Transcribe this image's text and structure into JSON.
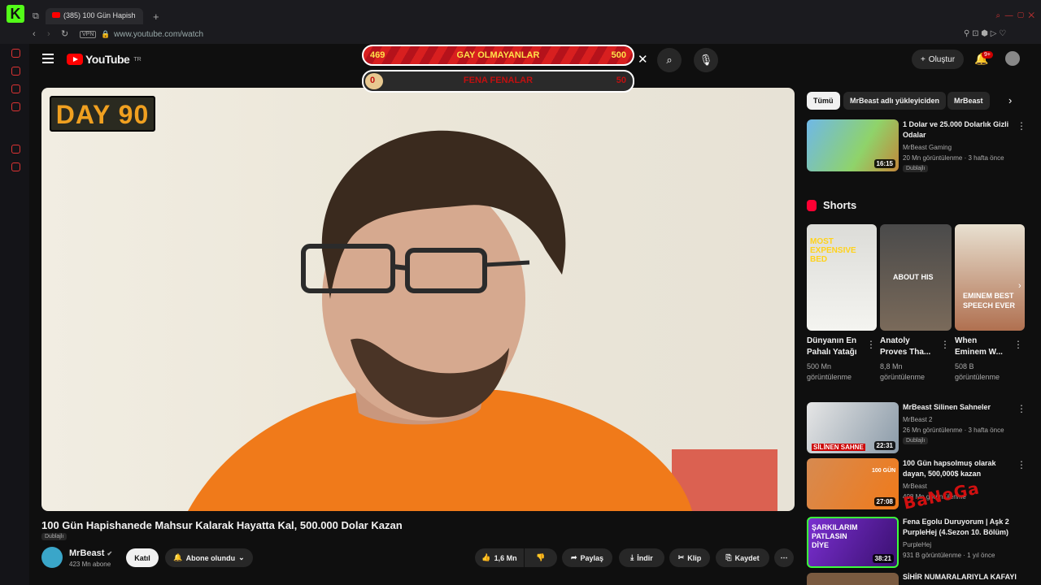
{
  "browser": {
    "tab_title": "(385) 100 Gün Hapish",
    "url": "www.youtube.com/watch",
    "vpn_label": "VPN"
  },
  "youtube": {
    "logo_text": "YouTube",
    "region": "TR",
    "create_label": "Oluştur",
    "notif_count": "9+"
  },
  "overlay": {
    "bar1": {
      "left": "469",
      "title": "GAY OLMAYANLAR",
      "right": "500"
    },
    "bar2": {
      "left": "0",
      "title": "FENA FENALAR",
      "right": "50"
    }
  },
  "video": {
    "badge": "DAY 90",
    "title": "100 Gün Hapishanede Mahsur Kalarak Hayatta Kal, 500.000 Dolar Kazan",
    "dubbed": "Dublajlı",
    "channel": "MrBeast",
    "subs": "423 Mn abone",
    "join": "Katıl",
    "subscribed": "Abone olundu",
    "likes": "1,6 Mn",
    "share": "Paylaş",
    "download": "İndir",
    "clip": "Klip",
    "save": "Kaydet"
  },
  "chips": [
    "Tümü",
    "MrBeast adlı yükleyiciden",
    "MrBeast"
  ],
  "recs": [
    {
      "title1": "1 Dolar ve 25.000 Dolarlık Gizli",
      "title2": "Odalar",
      "channel": "MrBeast Gaming",
      "meta": "20 Mn görüntülenme · 3 hafta önce",
      "badge": "Dublajlı",
      "dur": "16:15"
    },
    {
      "title1": "MrBeast Silinen Sahneler",
      "title2": "",
      "channel": "MrBeast 2",
      "meta": "26 Mn görüntülenme · 3 hafta önce",
      "badge": "Dublajlı",
      "dur": "22:31"
    },
    {
      "title1": "100 Gün hapsolmuş olarak",
      "title2": "dayan, 500,000$ kazan",
      "channel": "MrBeast",
      "meta": "408 Mn görüntülenme",
      "badge": "",
      "dur": "27:08"
    },
    {
      "title1": "Fena Egolu Duruyorum | Aşk 2",
      "title2": "PurpleHej (4.Sezon 10. Bölüm)",
      "channel": "PurpleHej",
      "meta": "931 B görüntülenme · 1 yıl önce",
      "badge": "",
      "dur": "38:21"
    },
    {
      "title1": "SİHİR NUMARALARIYLA KAFAYI",
      "title2": "",
      "channel": "",
      "meta": "",
      "badge": "",
      "dur": ""
    }
  ],
  "shorts": {
    "heading": "Shorts",
    "items": [
      {
        "t1": "Dünyanın En",
        "t2": "Pahalı Yatağı",
        "v1": "500 Mn",
        "v2": "görüntülenme",
        "thumb_text": "MOST EXPENSIVE BED"
      },
      {
        "t1": "Anatoly",
        "t2": "Proves Tha...",
        "v1": "8,8 Mn",
        "v2": "görüntülenme",
        "thumb_text": "ABOUT HIS"
      },
      {
        "t1": "When",
        "t2": "Eminem W...",
        "v1": "508 B",
        "v2": "görüntülenme",
        "thumb_text": "EMINEM BEST SPEECH EVER"
      }
    ]
  },
  "thumb_texts": {
    "rec1": "SİLİNEN SAHNE",
    "rec2": "100 GÜN",
    "rec3": "ŞARKILARIM PATLASIN DİYE"
  },
  "watermark": "BaNoGa"
}
